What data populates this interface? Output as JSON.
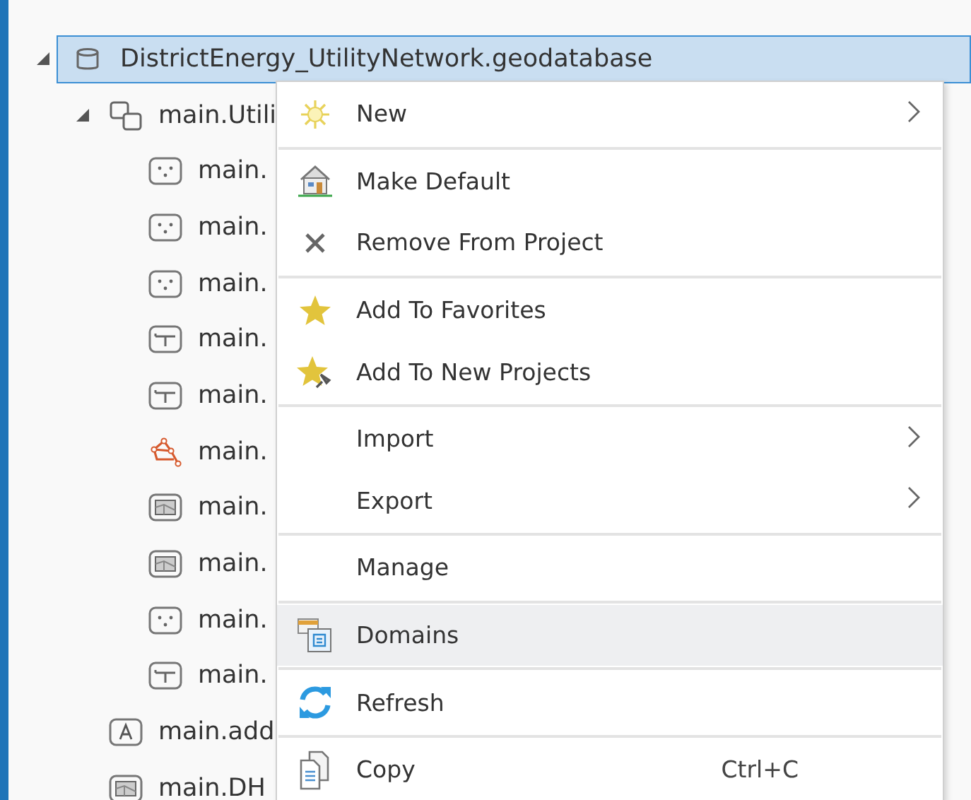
{
  "tree": [
    {
      "label": "DistrictEnergy_UtilityNetwork.geodatabase",
      "kind": "database",
      "expanded": true,
      "selected": true,
      "children": [
        {
          "label": "main.Utili",
          "kind": "dataset",
          "expanded": true,
          "selected": false,
          "children": [
            {
              "label": "main.",
              "kind": "point",
              "selected": false
            },
            {
              "label": "main.",
              "kind": "point",
              "selected": false
            },
            {
              "label": "main.",
              "kind": "point",
              "selected": false
            },
            {
              "label": "main.",
              "kind": "line",
              "selected": false
            },
            {
              "label": "main.",
              "kind": "line",
              "selected": false
            },
            {
              "label": "main.",
              "kind": "network",
              "selected": false
            },
            {
              "label": "main.",
              "kind": "polygon",
              "selected": false
            },
            {
              "label": "main.",
              "kind": "polygon",
              "selected": false
            },
            {
              "label": "main.",
              "kind": "point",
              "selected": false
            },
            {
              "label": "main.",
              "kind": "line",
              "selected": false
            }
          ]
        },
        {
          "label": "main.add",
          "kind": "annotation",
          "selected": false
        },
        {
          "label": "main.DH",
          "kind": "polygon",
          "selected": false
        }
      ]
    }
  ],
  "context_menu": [
    {
      "kind": "new",
      "label": "New",
      "submenu": true,
      "selected": false
    },
    {
      "kind": "separator"
    },
    {
      "kind": "make-default",
      "label": "Make Default",
      "submenu": false,
      "selected": false
    },
    {
      "kind": "remove",
      "label": "Remove From Project",
      "submenu": false,
      "selected": false
    },
    {
      "kind": "separator"
    },
    {
      "kind": "favorite",
      "label": "Add To Favorites",
      "submenu": false,
      "selected": false
    },
    {
      "kind": "favorite-new",
      "label": "Add To New Projects",
      "submenu": false,
      "selected": false
    },
    {
      "kind": "separator"
    },
    {
      "kind": "plain",
      "label": "Import",
      "submenu": true,
      "selected": false
    },
    {
      "kind": "plain",
      "label": "Export",
      "submenu": true,
      "selected": false
    },
    {
      "kind": "separator"
    },
    {
      "kind": "plain",
      "label": "Manage",
      "submenu": false,
      "selected": false
    },
    {
      "kind": "separator"
    },
    {
      "kind": "domains",
      "label": "Domains",
      "submenu": false,
      "selected": true
    },
    {
      "kind": "separator"
    },
    {
      "kind": "refresh",
      "label": "Refresh",
      "submenu": false,
      "selected": false
    },
    {
      "kind": "separator"
    },
    {
      "kind": "copy",
      "label": "Copy",
      "shortcut": "Ctrl+C",
      "submenu": false,
      "selected": false
    }
  ]
}
